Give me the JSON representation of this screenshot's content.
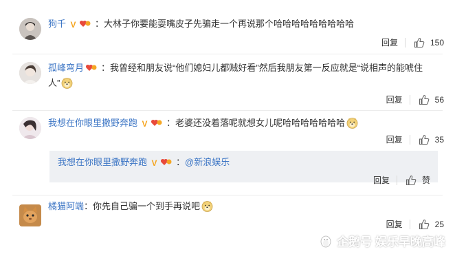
{
  "comments": [
    {
      "username": "狗千",
      "text": "大林子你要能耍嘴皮子先骗走一个再说那个哈哈哈哈哈哈哈哈哈",
      "reply_label": "回复",
      "likes": "150"
    },
    {
      "username": "孤峰弯月",
      "text_line1": "我曾经和朋友说“他们媳妇儿都贼好看”然后我朋友第一反应就是“说相声的能唬住",
      "text_line2": "人”",
      "reply_label": "回复",
      "likes": "56"
    },
    {
      "username": "我想在你眼里撒野奔跑",
      "text": "老婆还没着落呢就想女儿呢哈哈哈哈哈哈哈",
      "reply_label": "回复",
      "likes": "35"
    },
    {
      "username": "橘猫阿端",
      "text": "你先自己骗一个到手再说吧",
      "reply_label": "回复",
      "likes": "25"
    }
  ],
  "quote": {
    "username": "我想在你眼里撒野奔跑",
    "mention": "@新浪娱乐",
    "reply_label": "回复",
    "like_label": "赞"
  },
  "badges": {
    "verified": "V"
  },
  "watermark": {
    "text": "企鹅号 娱乐早晚高峰"
  },
  "colors": {
    "username": "#3d76c5",
    "badge": "#f5a623",
    "quote_bg": "#eef0f3"
  }
}
